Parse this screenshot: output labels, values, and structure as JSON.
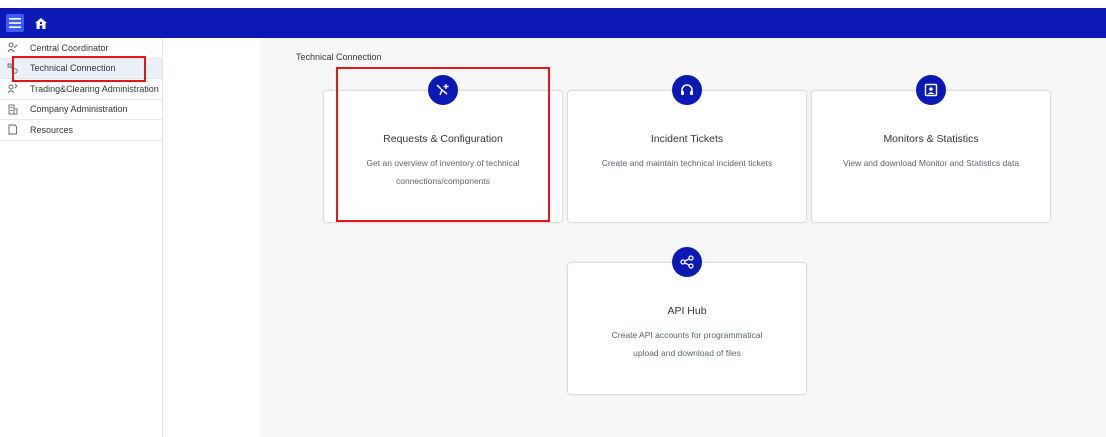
{
  "sidebar": {
    "items": [
      {
        "label": "Central Coordinator",
        "icon": "coordinator-icon"
      },
      {
        "label": "Technical Connection",
        "icon": "technical-connection-icon"
      },
      {
        "label": "Trading&Clearing Administration",
        "icon": "trading-admin-icon"
      },
      {
        "label": "Company Administration",
        "icon": "company-icon"
      },
      {
        "label": "Resources",
        "icon": "resources-icon"
      }
    ]
  },
  "breadcrumb": "Technical Connection",
  "cards": [
    {
      "title": "Requests & Configuration",
      "desc": "Get an overview of inventory of technical connections/components",
      "icon": "tools-icon"
    },
    {
      "title": "Incident Tickets",
      "desc": "Create and maintain technical incident tickets",
      "icon": "headset-icon"
    },
    {
      "title": "Monitors & Statistics",
      "desc": "View and download Monitor and Statistics data",
      "icon": "monitor-icon"
    },
    {
      "title": "API Hub",
      "desc": "Create API accounts for programmatical upload and download of files",
      "icon": "share-icon"
    }
  ],
  "colors": {
    "brand": "#0a18b4",
    "highlight": "#e3151a",
    "background": "#f7f7f7"
  }
}
